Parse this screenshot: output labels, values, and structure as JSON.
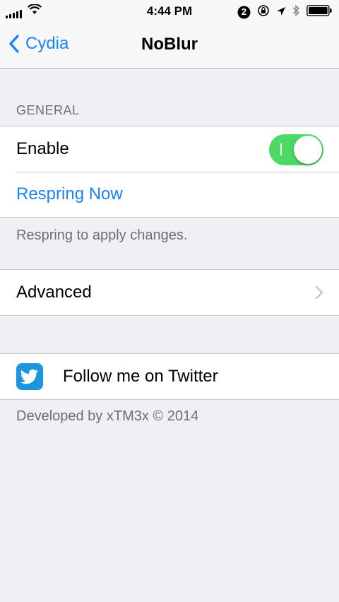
{
  "status_bar": {
    "time": "4:44 PM",
    "notification_count": "2"
  },
  "nav": {
    "back_label": "Cydia",
    "title": "NoBlur"
  },
  "general": {
    "header": "GENERAL",
    "enable_label": "Enable",
    "enable_on": true,
    "respring_label": "Respring Now",
    "footer": "Respring to apply changes."
  },
  "advanced": {
    "label": "Advanced"
  },
  "social": {
    "twitter_label": "Follow me on Twitter",
    "footer": "Developed by xTM3x © 2014"
  },
  "colors": {
    "accent": "#1a82fb",
    "toggle_on": "#4cd964",
    "background": "#efeff4",
    "twitter": "#1b95e0"
  }
}
